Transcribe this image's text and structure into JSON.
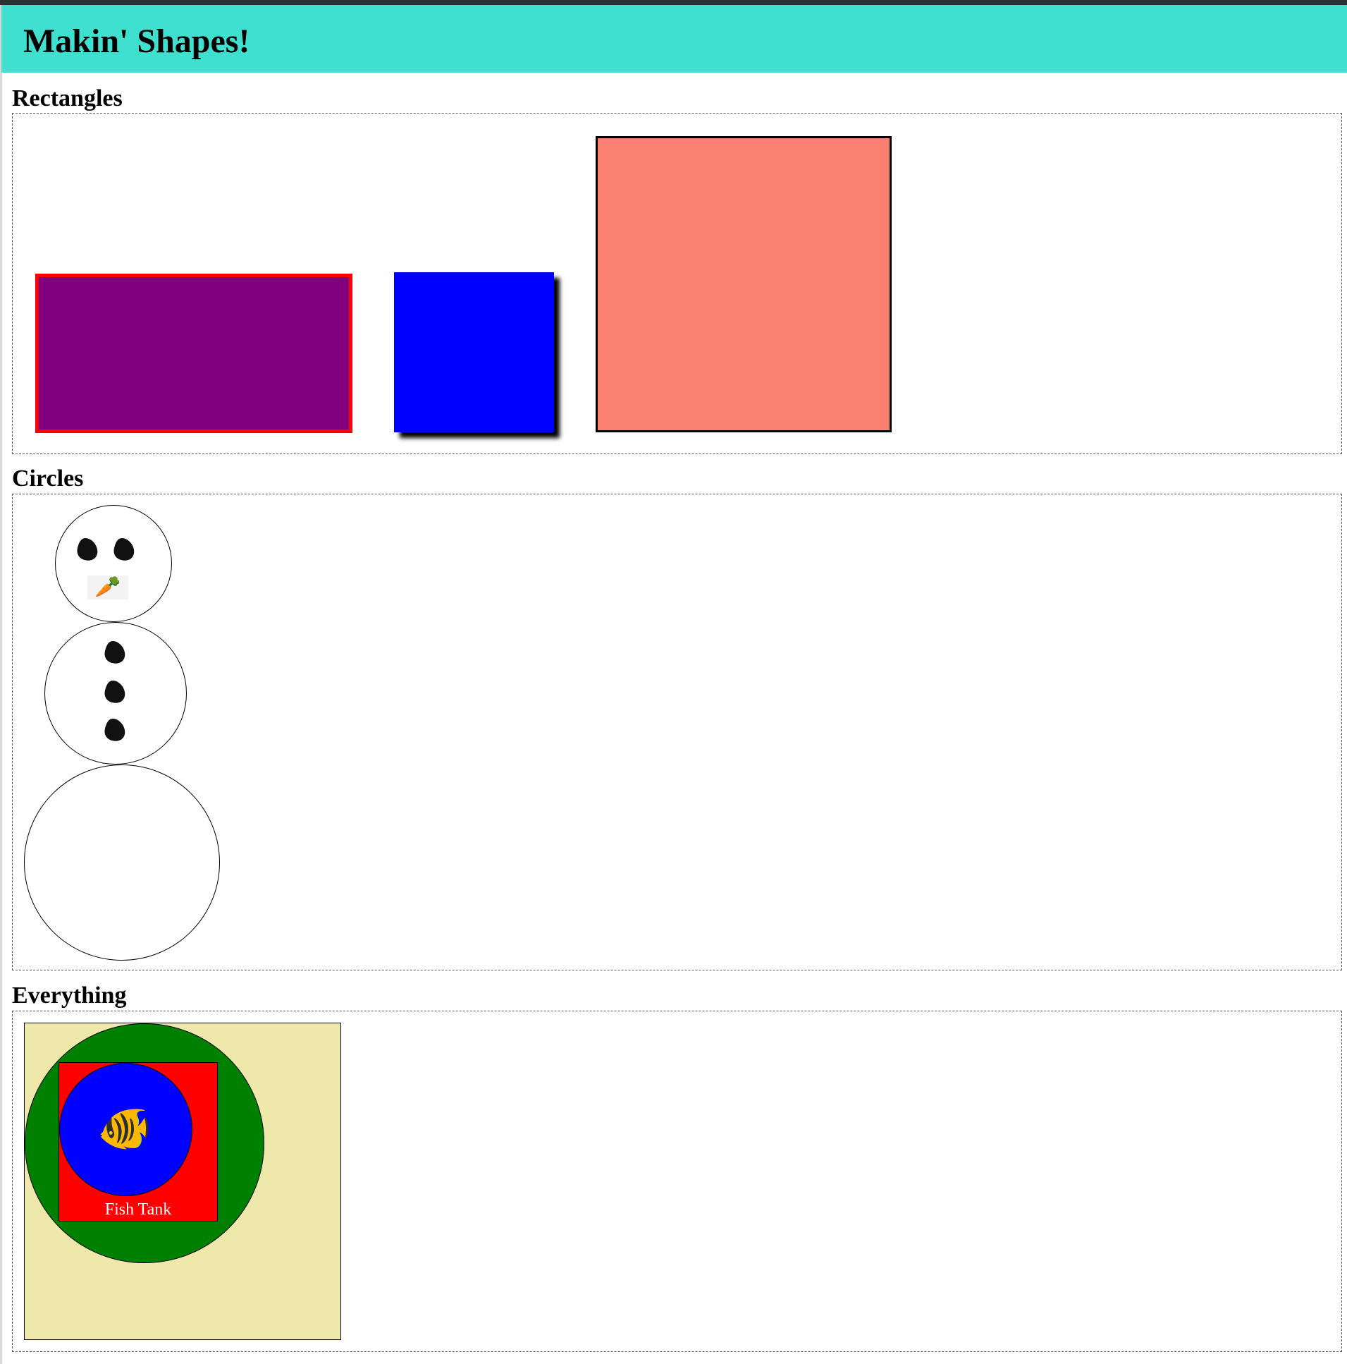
{
  "header": {
    "title": "Makin' Shapes!",
    "background": "#40e0d0"
  },
  "sections": {
    "rectangles": {
      "title": "Rectangles",
      "shapes": [
        {
          "fill": "#800080",
          "border": "#ff0000"
        },
        {
          "fill": "#0000ff",
          "shadow": "#000000"
        },
        {
          "fill": "#fa8072",
          "border": "#000000"
        }
      ]
    },
    "circles": {
      "title": "Circles",
      "snowman": {
        "head_features": [
          "coal-eye",
          "coal-eye",
          "carrot-nose"
        ],
        "body_buttons": 3,
        "carrot_icon": "🥕"
      }
    },
    "everything": {
      "title": "Everything",
      "colors": {
        "background": "#eee8aa",
        "outer_circle": "#008000",
        "square": "#ff0000",
        "inner_circle": "#0000ff"
      },
      "fish_icon": "🐠",
      "label": "Fish Tank"
    }
  }
}
